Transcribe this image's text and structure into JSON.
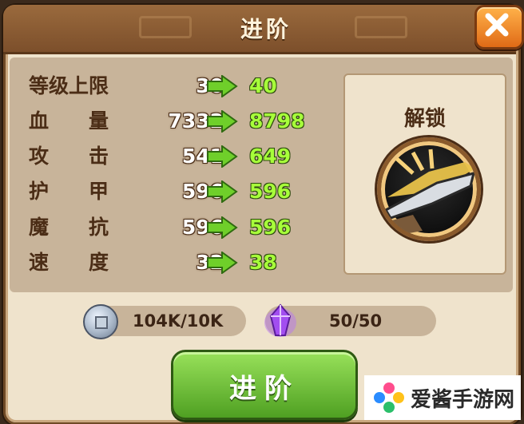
{
  "dialog": {
    "title": "进阶",
    "close_icon": "close-icon"
  },
  "stats": [
    {
      "label": "等级上限",
      "old": "30",
      "new": "40"
    },
    {
      "label": "血　　量",
      "old": "7332",
      "new": "8798"
    },
    {
      "label": "攻　　击",
      "old": "541",
      "new": "649"
    },
    {
      "label": "护　　甲",
      "old": "596",
      "new": "596"
    },
    {
      "label": "魔　　抗",
      "old": "596",
      "new": "596"
    },
    {
      "label": "速　　度",
      "old": "32",
      "new": "38"
    }
  ],
  "unlock": {
    "title": "解锁",
    "skill_icon": "blade-skill-icon"
  },
  "costs": {
    "coins": {
      "icon": "coin-icon",
      "value": "104K/10K"
    },
    "crystal": {
      "icon": "purple-crystal-icon",
      "value": "50/50"
    }
  },
  "action": {
    "label": "进阶"
  },
  "watermark": {
    "text": "爱酱手游网"
  },
  "colors": {
    "new_value": "#a7ff3a",
    "arrow": "#6fcf2a",
    "header": "#8a5a33",
    "button_green": "#5fb52a",
    "close_orange": "#f08a25"
  }
}
